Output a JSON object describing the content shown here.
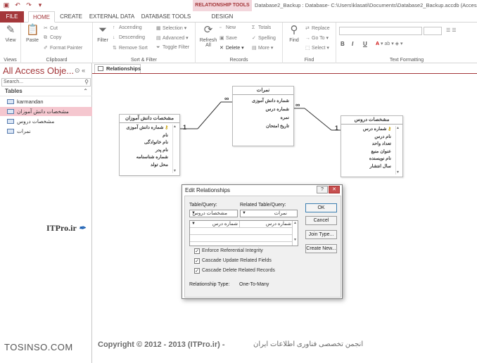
{
  "qat": {
    "items": [
      "save-icon",
      "undo-icon",
      "redo-icon",
      "customize-icon"
    ]
  },
  "contextual_tab": "RELATIONSHIP TOOLS",
  "window_title": "Database2_Backup : Database- C:\\Users\\klasati\\Documents\\Database2_Backup.accdb (Access 2007",
  "tabs": {
    "file": "FILE",
    "home": "HOME",
    "create": "CREATE",
    "external": "EXTERNAL DATA",
    "dbtools": "DATABASE TOOLS",
    "design": "DESIGN"
  },
  "ribbon": {
    "views": {
      "view": "View",
      "label": "Views"
    },
    "clipboard": {
      "paste": "Paste",
      "cut": "Cut",
      "copy": "Copy",
      "format_painter": "Format Painter",
      "label": "Clipboard"
    },
    "sort": {
      "filter": "Filter",
      "ascending": "Ascending",
      "descending": "Descending",
      "remove_sort": "Remove Sort",
      "selection": "Selection",
      "advanced": "Advanced",
      "toggle_filter": "Toggle Filter",
      "label": "Sort & Filter"
    },
    "records": {
      "refresh": "Refresh",
      "refresh_all": "All",
      "new": "New",
      "save": "Save",
      "delete": "Delete",
      "totals": "Totals",
      "spelling": "Spelling",
      "more": "More",
      "label": "Records"
    },
    "find": {
      "find": "Find",
      "replace": "Replace",
      "goto": "Go To",
      "select": "Select",
      "label": "Find"
    },
    "text": {
      "bold": "B",
      "italic": "I",
      "underline": "U",
      "label": "Text Formatting"
    }
  },
  "nav": {
    "title": "All Access Obje...",
    "search_placeholder": "Search...",
    "section": "Tables",
    "items": [
      "karmandan",
      "مشخصات دانش آموزان",
      "مشخصات دروس",
      "نمرات"
    ]
  },
  "watermark": {
    "itpro": "ITPro.ir",
    "tosinso": "TOSINSO.COM"
  },
  "doc_tab": "Relationships",
  "tables": {
    "students": {
      "title": "مشخصات دانش آموزان",
      "fields": [
        "شماره دانش آموزی",
        "نام",
        "نام خانوادگی",
        "نام پدر",
        "شماره شناسنامه",
        "محل تولد"
      ]
    },
    "grades": {
      "title": "نمرات",
      "fields": [
        "شماره دانش آموزی",
        "شماره درس",
        "نمره",
        "تاریخ امتحان"
      ]
    },
    "courses": {
      "title": "مشخصات دروس",
      "fields": [
        "شماره درس",
        "نام درس",
        "تعداد واحد",
        "عنوان منبع",
        "نام نويسنده",
        "سال انتشار"
      ]
    }
  },
  "cardinality": {
    "one": "1",
    "many": "∞"
  },
  "dialog": {
    "title": "Edit Relationships",
    "table_query_label": "Table/Query:",
    "related_label": "Related Table/Query:",
    "table_value": "مشخصات دروس",
    "related_value": "نمرات",
    "field_left": "شماره درس",
    "field_right": "شماره درس",
    "ok": "OK",
    "cancel": "Cancel",
    "join_type": "Join Type...",
    "create_new": "Create New...",
    "enforce": "Enforce Referential Integrity",
    "cascade_update": "Cascade Update Related Fields",
    "cascade_delete": "Cascade Delete Related Records",
    "rel_type_label": "Relationship Type:",
    "rel_type_value": "One-To-Many"
  },
  "copyright": "Copyright © 2012 - 2013 (ITPro.ir) -",
  "copyright_fa": "انجمن تخصصی فناوری اطلاعات ایران",
  "colors": {
    "accent": "#a4373a",
    "selected_nav": "#f5c7cf"
  }
}
